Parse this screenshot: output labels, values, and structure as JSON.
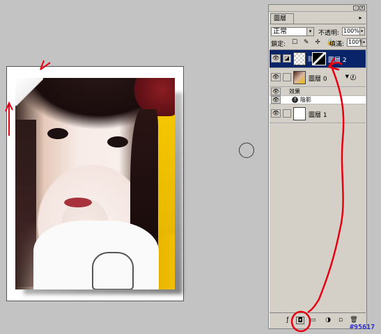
{
  "canvas": {
    "document_label": "photo document"
  },
  "layers_panel": {
    "tab_label": "圖層",
    "menu_icon": "triangle-right-icon",
    "blend_mode": "正常",
    "opacity_label": "不透明:",
    "opacity_value": "100%",
    "lock_label": "鎖定:",
    "fill_label": "填滿:",
    "fill_value": "100%",
    "lock_icons": "☐ ✎ ✢ 🔒",
    "layers": [
      {
        "name": "圖層 2",
        "selected": true,
        "has_mask": true
      },
      {
        "name": "圖層 0",
        "has_effects": true,
        "fx": "ⓕ"
      },
      {
        "name": "圖層 1"
      }
    ],
    "effects_label": "效果",
    "drop_shadow_label": "陰影",
    "bottom_buttons": [
      "link-icon",
      "add-style-icon",
      "add-mask-icon",
      "new-set-icon",
      "new-fill-layer-icon",
      "new-layer-icon",
      "trash-icon"
    ]
  },
  "watermark": "#95617",
  "colors": {
    "annotation_red": "#e60012",
    "selection_blue": "#0a246a",
    "panel_gray": "#d4d0c8",
    "background": "#c3c3c3"
  }
}
